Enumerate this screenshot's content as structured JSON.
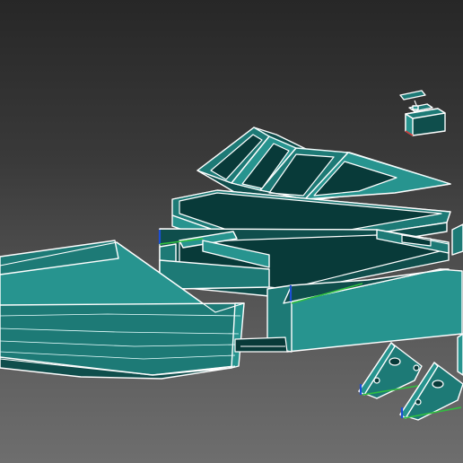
{
  "viewport": {
    "background_top": "#272727",
    "background_bottom": "#6e6e6e"
  },
  "colors": {
    "part_fill": "#1d7a76",
    "part_fill_light": "#27948f",
    "part_fill_dark": "#0f4e4c",
    "edge": "#ffffff",
    "axis_x": "#d03030",
    "axis_y": "#30c040",
    "axis_z": "#1d4fd6"
  },
  "parts": [
    {
      "name": "servo-motor",
      "icon": "servo-icon"
    },
    {
      "name": "cabin-windshield",
      "icon": "windshield-icon"
    },
    {
      "name": "deck-lid",
      "icon": "panel-icon"
    },
    {
      "name": "hull-bow",
      "icon": "hull-icon"
    },
    {
      "name": "hull-mid-frame",
      "icon": "frame-icon"
    },
    {
      "name": "hull-stern",
      "icon": "hull-icon"
    },
    {
      "name": "motor-mount-bracket-left",
      "icon": "bracket-icon"
    },
    {
      "name": "motor-mount-bracket-right",
      "icon": "bracket-icon"
    }
  ]
}
